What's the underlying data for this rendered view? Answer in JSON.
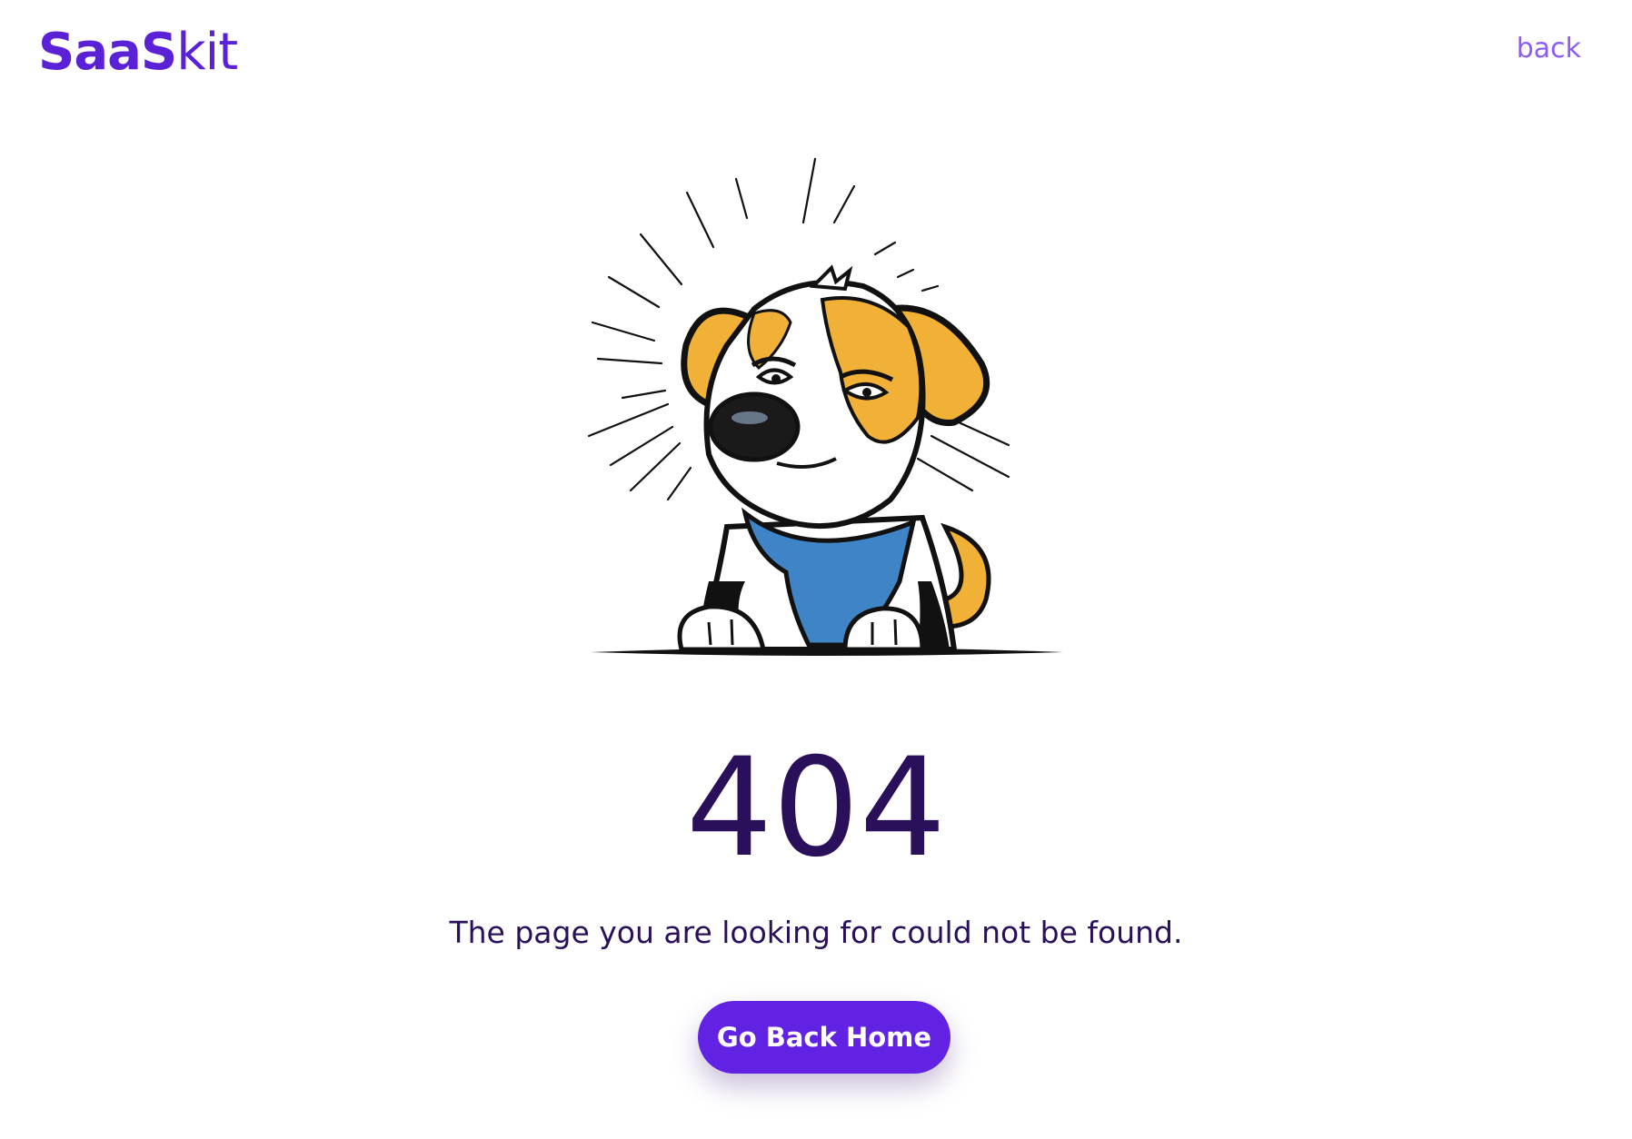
{
  "header": {
    "logo_bold": "SaaS",
    "logo_light": "kit",
    "back_label": "back"
  },
  "main": {
    "code": "404",
    "message": "The page you are looking for could not be found.",
    "home_button_label": "Go Back Home"
  },
  "colors": {
    "brand": "#5b21d6",
    "button": "#6222e4",
    "link": "#8b5cf6",
    "text": "#2a0f5a"
  },
  "icons": {
    "illustration": "sad-dog-illustration"
  }
}
